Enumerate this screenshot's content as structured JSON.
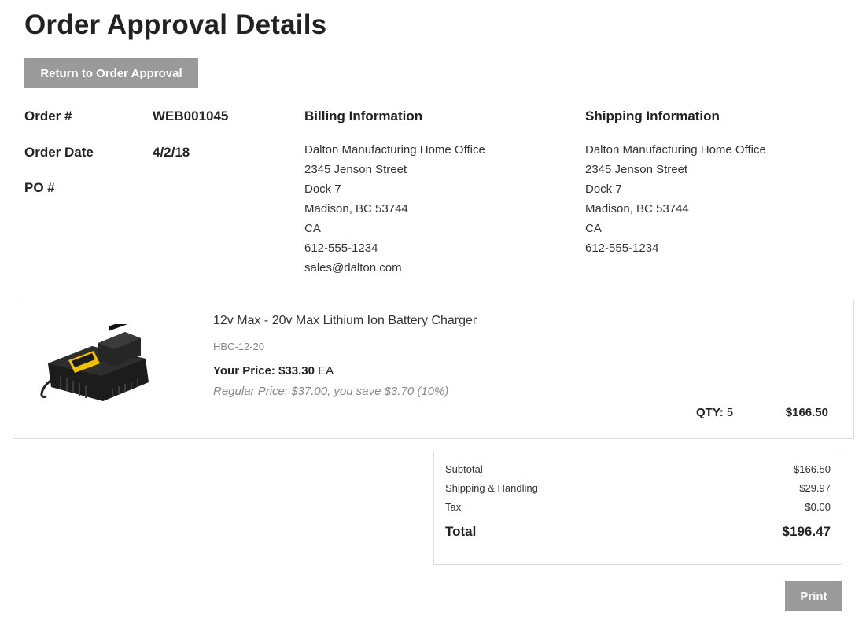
{
  "page": {
    "title": "Order Approval Details",
    "return_button": "Return to Order Approval",
    "print_button": "Print"
  },
  "order": {
    "order_number_label": "Order #",
    "order_number": "WEB001045",
    "order_date_label": "Order Date",
    "order_date": "4/2/18",
    "po_label": "PO #"
  },
  "billing": {
    "heading": "Billing Information",
    "lines": [
      "Dalton Manufacturing Home Office",
      "2345 Jenson Street",
      "Dock 7",
      "Madison, BC 53744",
      "CA",
      "612-555-1234",
      "sales@dalton.com"
    ]
  },
  "shipping": {
    "heading": "Shipping Information",
    "lines": [
      "Dalton Manufacturing Home Office",
      "2345 Jenson Street",
      "Dock 7",
      "Madison, BC 53744",
      "CA",
      "612-555-1234"
    ]
  },
  "item": {
    "name": "12v Max - 20v Max Lithium Ion Battery Charger",
    "sku": "HBC-12-20",
    "your_price_label": "Your Price:",
    "your_price": "$33.30",
    "unit": "EA",
    "regular_price_text": "Regular Price: $37.00, you save $3.70 (10%)",
    "qty_label": "QTY:",
    "qty": "5",
    "line_total": "$166.50",
    "image_icon": "battery-charger-product-image"
  },
  "summary": {
    "subtotal_label": "Subtotal",
    "subtotal": "$166.50",
    "shipping_label": "Shipping & Handling",
    "shipping": "$29.97",
    "tax_label": "Tax",
    "tax": "$0.00",
    "total_label": "Total",
    "total": "$196.47"
  },
  "colors": {
    "button_gray": "#9a9a9a",
    "text_dark": "#222222",
    "text_muted": "#888888",
    "border": "#dcdcdc",
    "charger_yellow": "#f2c200"
  }
}
